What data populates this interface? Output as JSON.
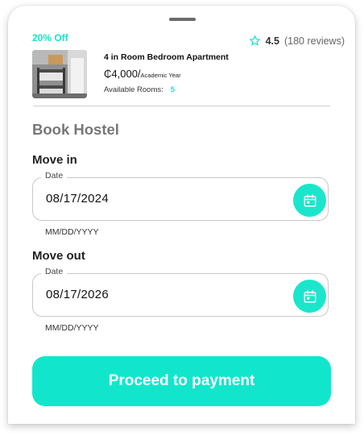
{
  "listing": {
    "discount": "20% Off",
    "rating": "4.5",
    "reviews": "(180 reviews)",
    "title": "4 in Room Bedroom Apartment",
    "price": "₵4,000/",
    "price_period": "Academic Year",
    "rooms_label": "Available Rooms:",
    "rooms_count": "5"
  },
  "booking": {
    "section_title": "Book Hostel",
    "move_in": {
      "label": "Move in",
      "field_legend": "Date",
      "value": "08/17/2024",
      "hint": "MM/DD/YYYY"
    },
    "move_out": {
      "label": "Move out",
      "field_legend": "Date",
      "value": "08/17/2026",
      "hint": "MM/DD/YYYY"
    },
    "cta": "Proceed to payment"
  },
  "colors": {
    "accent": "#19e3c8",
    "cta": "#11e6cd",
    "section_title": "#777777"
  },
  "icons": {
    "rating": "star-outline-icon",
    "date_picker": "calendar-icon"
  }
}
